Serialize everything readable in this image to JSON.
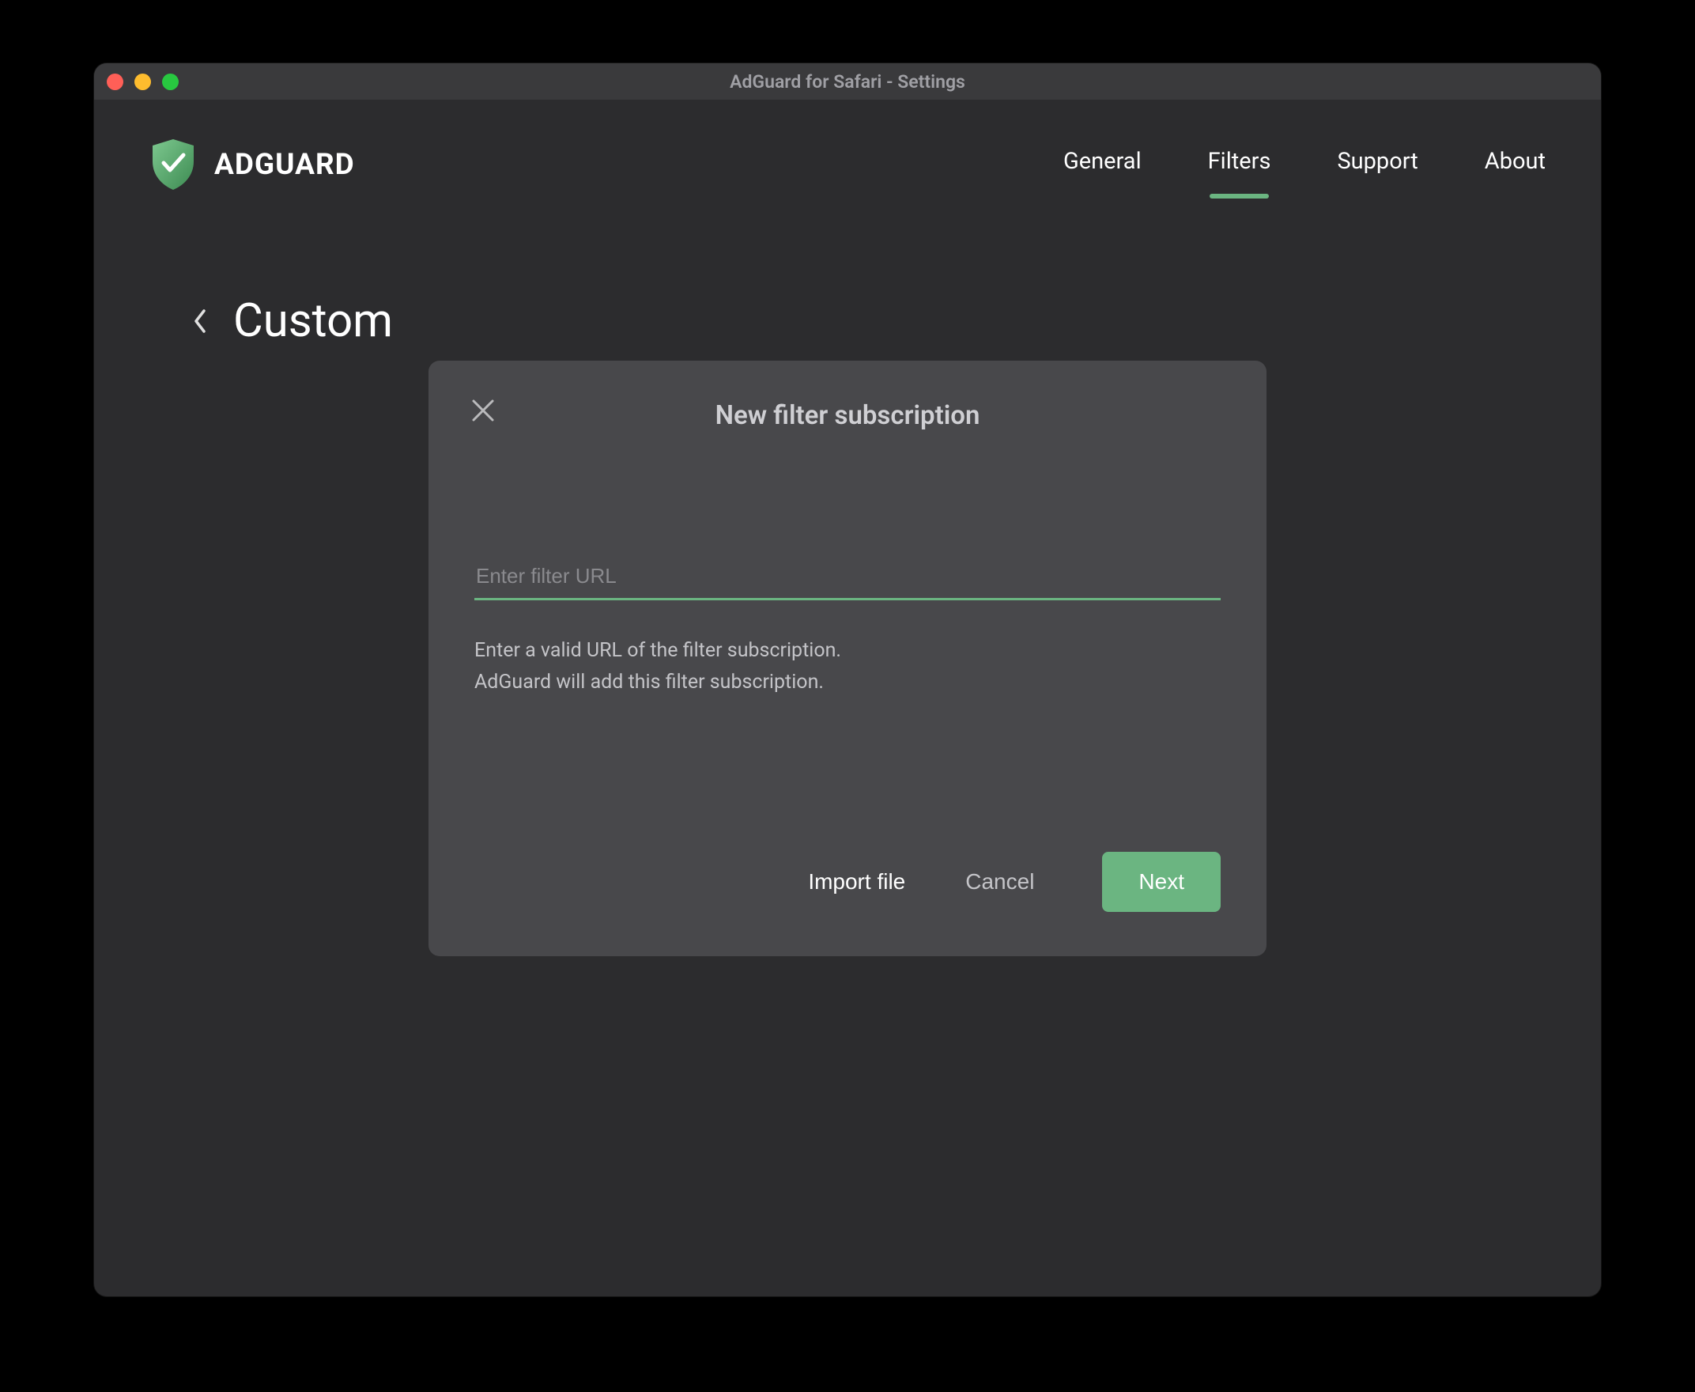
{
  "window": {
    "title": "AdGuard for Safari - Settings"
  },
  "header": {
    "logo_text": "ADGUARD",
    "nav": [
      {
        "label": "General"
      },
      {
        "label": "Filters",
        "active": true
      },
      {
        "label": "Support"
      },
      {
        "label": "About"
      }
    ]
  },
  "page": {
    "title": "Custom"
  },
  "modal": {
    "title": "New filter subscription",
    "input_placeholder": "Enter filter URL",
    "input_value": "",
    "help_line1": "Enter a valid URL of the filter subscription.",
    "help_line2": "AdGuard will add this filter subscription.",
    "buttons": {
      "import": "Import file",
      "cancel": "Cancel",
      "next": "Next"
    }
  },
  "colors": {
    "accent": "#6bb581",
    "window_bg": "#2c2c2e",
    "modal_bg": "#48484b"
  }
}
